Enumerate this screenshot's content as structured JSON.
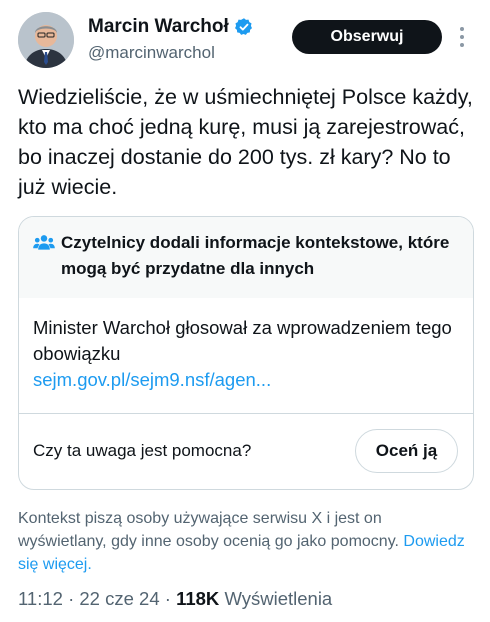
{
  "author": {
    "display_name": "Marcin Warchoł",
    "handle": "@marcinwarchol",
    "verified_color": "#1d9bf0"
  },
  "actions": {
    "follow_label": "Obserwuj"
  },
  "tweet": {
    "text": "Wiedzieliście, że w uśmiechniętej Polsce każdy, kto ma choć jedną kurę, musi ją zarejestrować, bo inaczej dostanie do 200 tys. zł kary? No to już wiecie."
  },
  "community_note": {
    "title": "Czytelnicy dodali informacje kontekstowe, które mogą być przydatne dla innych",
    "body": "Minister Warchoł głosował za wprowadzeniem tego obowiązku",
    "link": "sejm.gov.pl/sejm9.nsf/agen...",
    "question": "Czy ta uwaga jest pomocna?",
    "rate_label": "Oceń ją"
  },
  "context_info": {
    "text": "Kontekst piszą osoby używające serwisu X i jest on wyświetlany, gdy inne osoby ocenią go jako pomocny.",
    "link": "Dowiedz się więcej."
  },
  "meta": {
    "time": "11:12",
    "date": "22 cze 24",
    "views_count": "118K",
    "views_label": "Wyświetlenia"
  },
  "colors": {
    "accent": "#1d9bf0",
    "text": "#0f1419",
    "secondary": "#536471"
  }
}
